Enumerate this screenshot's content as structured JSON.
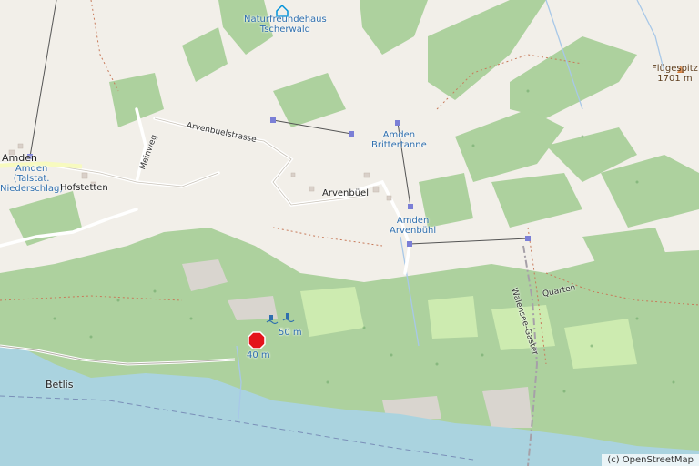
{
  "map": {
    "labels": {
      "naturfreundehaus": "Naturfreundehaus\nTscherwald",
      "amden_town": "Amden",
      "amden_talstat": "Amden\n(Talstat.\nNiederschlag)",
      "hofstetten": "Hofstetten",
      "meinweg": "Meinweg",
      "arvenbuelstrasse": "Arvenbuelstrasse",
      "arvenbuel": "Arvenbüel",
      "amden_brittertanne": "Amden\nBrittertanne",
      "amden_arvenbuehl": "Amden\nArvenbühl",
      "fluegespitz": "Flügespitz\n1701 m",
      "quarten": "Quarten",
      "walensee_gaster": "Walensee-Gaster",
      "betlis": "Betlis",
      "height_50": "50 m",
      "height_40": "40 m"
    },
    "marker_color": "#e4141b",
    "colors": {
      "forest": "#add19e",
      "land": "#f2efe9",
      "water": "#aad3df",
      "meadow": "#cdebb0"
    },
    "attribution": "(c) OpenStreetMap"
  }
}
